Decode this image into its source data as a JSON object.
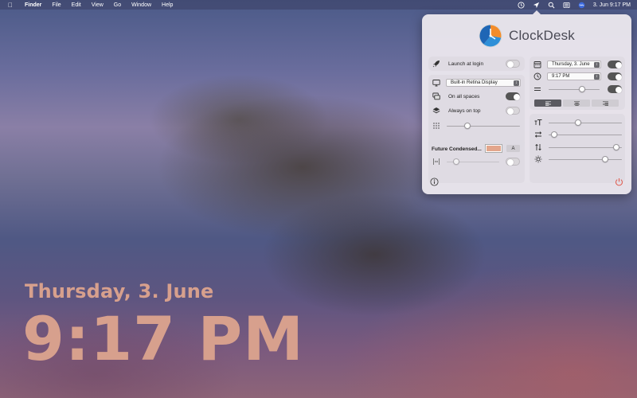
{
  "menubar": {
    "app": "Finder",
    "menus": [
      "File",
      "Edit",
      "View",
      "Go",
      "Window",
      "Help"
    ],
    "datetime": "3. Jun  9:17 PM",
    "status_icons": [
      "clock-icon",
      "location-arrow-icon",
      "search-icon",
      "control-center-icon",
      "siri-icon"
    ]
  },
  "desktop_clock": {
    "date": "Thursday, 3. June",
    "time": "9:17 PM",
    "color": "#d7a08d"
  },
  "panel": {
    "title": "ClockDesk",
    "left": {
      "launch_at_login": {
        "label": "Launch at login",
        "on": false
      },
      "display": {
        "selected": "Built-in Retina Display"
      },
      "on_all_spaces": {
        "label": "On all spaces",
        "on": true
      },
      "always_on_top": {
        "label": "Always on top",
        "on": false
      },
      "grid_opacity": {
        "value": 0.28
      },
      "font": {
        "name": "Future Condensed...",
        "color": "#e3a68c",
        "button_label": "A"
      },
      "spacing_slider": {
        "value": 0.18,
        "on": false
      }
    },
    "right": {
      "date_format": {
        "selected": "Thursday, 3. June",
        "on": true
      },
      "time_format": {
        "selected": "9:17 PM",
        "on": true
      },
      "separator": {
        "value": 0.66,
        "on": true
      },
      "alignment": {
        "options": [
          "align-left-icon",
          "align-center-icon",
          "align-right-icon"
        ],
        "active_index": 0
      },
      "size_slider": {
        "value": 0.4
      },
      "horizontal_offset": {
        "value": 0.08
      },
      "vertical_offset": {
        "value": 0.92
      },
      "brightness": {
        "value": 0.77
      }
    },
    "footer": {
      "info_icon": "info-icon",
      "power_icon": "power-icon"
    }
  }
}
